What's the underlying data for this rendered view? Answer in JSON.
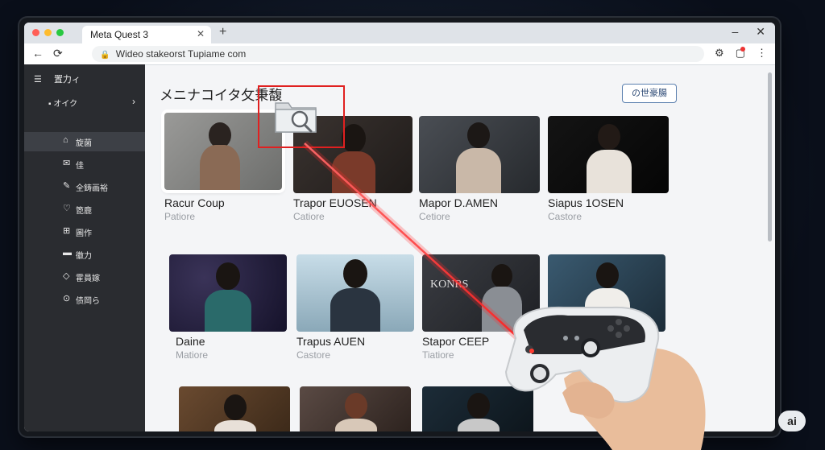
{
  "browser": {
    "tab_title": "Meta Quest 3",
    "tab_close": "✕",
    "new_tab": "+",
    "url": "Wideo stakeorst Tupiame com",
    "nav_back": "←",
    "nav_reload": "⟳"
  },
  "sidebar": {
    "header": "置力ィ",
    "section": "オイク",
    "items": [
      {
        "icon": "home-icon",
        "label": "旋菌"
      },
      {
        "icon": "mail-icon",
        "label": "佳"
      },
      {
        "icon": "pencil-icon",
        "label": "全鋳画裕"
      },
      {
        "icon": "heart-icon",
        "label": "箆鹿"
      },
      {
        "icon": "grid-icon",
        "label": "圖作"
      },
      {
        "icon": "folder-icon",
        "label": "徽力"
      },
      {
        "icon": "tag-icon",
        "label": "霍員嫁"
      },
      {
        "icon": "coin-icon",
        "label": "债岡ら"
      }
    ]
  },
  "main": {
    "title": "メニナコイタ攵秉馥",
    "more_button": "の世豪腸",
    "cards": [
      {
        "title": "Racur Coup",
        "subtitle": "Patiore"
      },
      {
        "title": "Trapor EUOSEN",
        "subtitle": "Catiore"
      },
      {
        "title": "Mapor D.AMEN",
        "subtitle": "Cetiore"
      },
      {
        "title": "Siapus 1OSEN",
        "subtitle": "Castore"
      },
      {
        "title": "Daine",
        "subtitle": "Matiore"
      },
      {
        "title": "Trapus AUEN",
        "subtitle": "Castore"
      },
      {
        "title": "Stapor CEEP",
        "subtitle": "Tiatiore"
      },
      {
        "title": "",
        "subtitle": ""
      }
    ],
    "thumb_overlay_text": "KONRS"
  },
  "overlay": {
    "ai_badge": "ai",
    "laser_color": "#ff2a2a"
  },
  "colors": {
    "accent_border": "#5a7fae",
    "selection": "#e02020",
    "sidebar_bg": "#2a2c30"
  }
}
